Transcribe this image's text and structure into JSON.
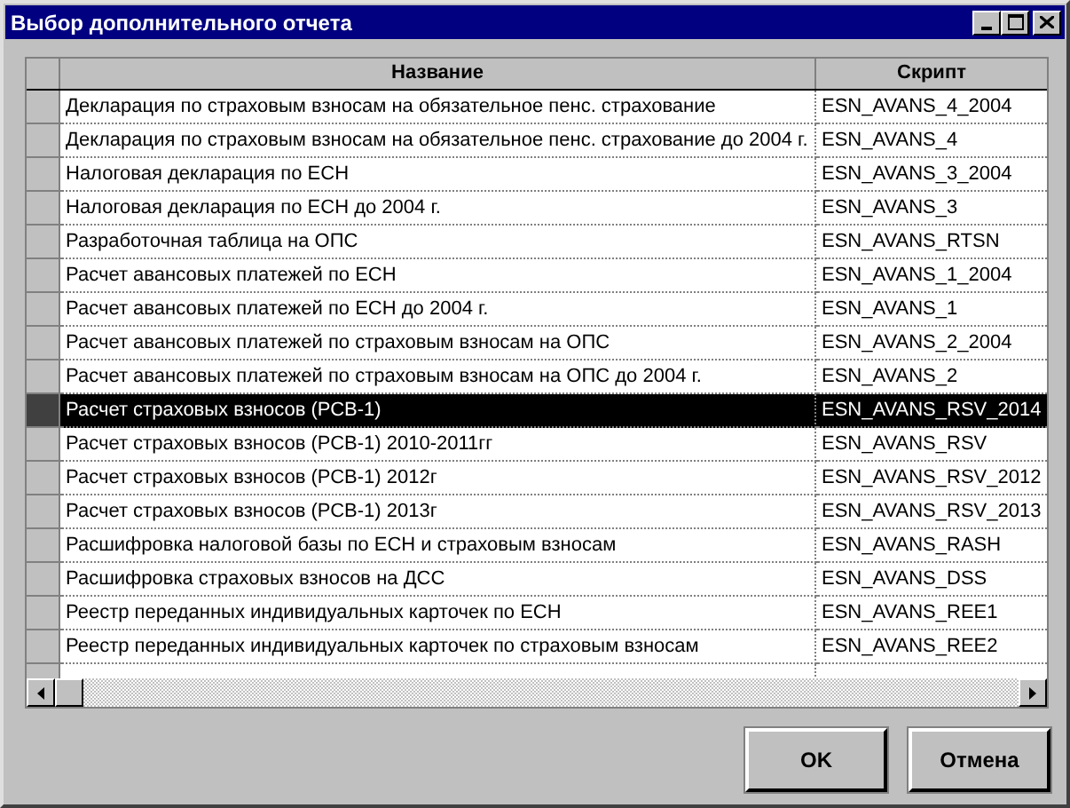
{
  "window": {
    "title": "Выбор дополнительного отчета"
  },
  "table": {
    "columns": [
      "Название",
      "Скрипт"
    ],
    "rows": [
      {
        "name": "Декларация по страховым взносам на обязательное пенс. страхование",
        "script": "ESN_AVANS_4_2004",
        "selected": false
      },
      {
        "name": "Декларация по страховым взносам на обязательное пенс. страхование до 2004 г.",
        "script": "ESN_AVANS_4",
        "selected": false
      },
      {
        "name": "Налоговая декларация по ЕСН",
        "script": "ESN_AVANS_3_2004",
        "selected": false
      },
      {
        "name": "Налоговая декларация по ЕСН до 2004 г.",
        "script": "ESN_AVANS_3",
        "selected": false
      },
      {
        "name": "Разработочная таблица на ОПС",
        "script": "ESN_AVANS_RTSN",
        "selected": false
      },
      {
        "name": "Расчет авансовых платежей по ЕСН",
        "script": "ESN_AVANS_1_2004",
        "selected": false
      },
      {
        "name": "Расчет авансовых платежей по ЕСН до 2004 г.",
        "script": "ESN_AVANS_1",
        "selected": false
      },
      {
        "name": "Расчет авансовых платежей по страховым взносам на ОПС",
        "script": "ESN_AVANS_2_2004",
        "selected": false
      },
      {
        "name": "Расчет авансовых платежей по страховым взносам на ОПС до 2004 г.",
        "script": "ESN_AVANS_2",
        "selected": false
      },
      {
        "name": "Расчет страховых взносов (РСВ-1)",
        "script": "ESN_AVANS_RSV_2014",
        "selected": true
      },
      {
        "name": "Расчет страховых взносов (РСВ-1) 2010-2011гг",
        "script": "ESN_AVANS_RSV",
        "selected": false
      },
      {
        "name": "Расчет страховых взносов (РСВ-1) 2012г",
        "script": "ESN_AVANS_RSV_2012",
        "selected": false
      },
      {
        "name": "Расчет страховых взносов (РСВ-1) 2013г",
        "script": "ESN_AVANS_RSV_2013",
        "selected": false
      },
      {
        "name": "Расшифровка налоговой базы по ЕСН и страховым взносам",
        "script": "ESN_AVANS_RASH",
        "selected": false
      },
      {
        "name": "Расшифровка страховых взносов на ДСС",
        "script": "ESN_AVANS_DSS",
        "selected": false
      },
      {
        "name": "Реестр переданных индивидуальных карточек по ЕСН",
        "script": "ESN_AVANS_REE1",
        "selected": false
      },
      {
        "name": "Реестр переданных индивидуальных карточек по страховым взносам",
        "script": "ESN_AVANS_REE2",
        "selected": false
      }
    ]
  },
  "buttons": [
    "OK",
    "Отмена"
  ]
}
